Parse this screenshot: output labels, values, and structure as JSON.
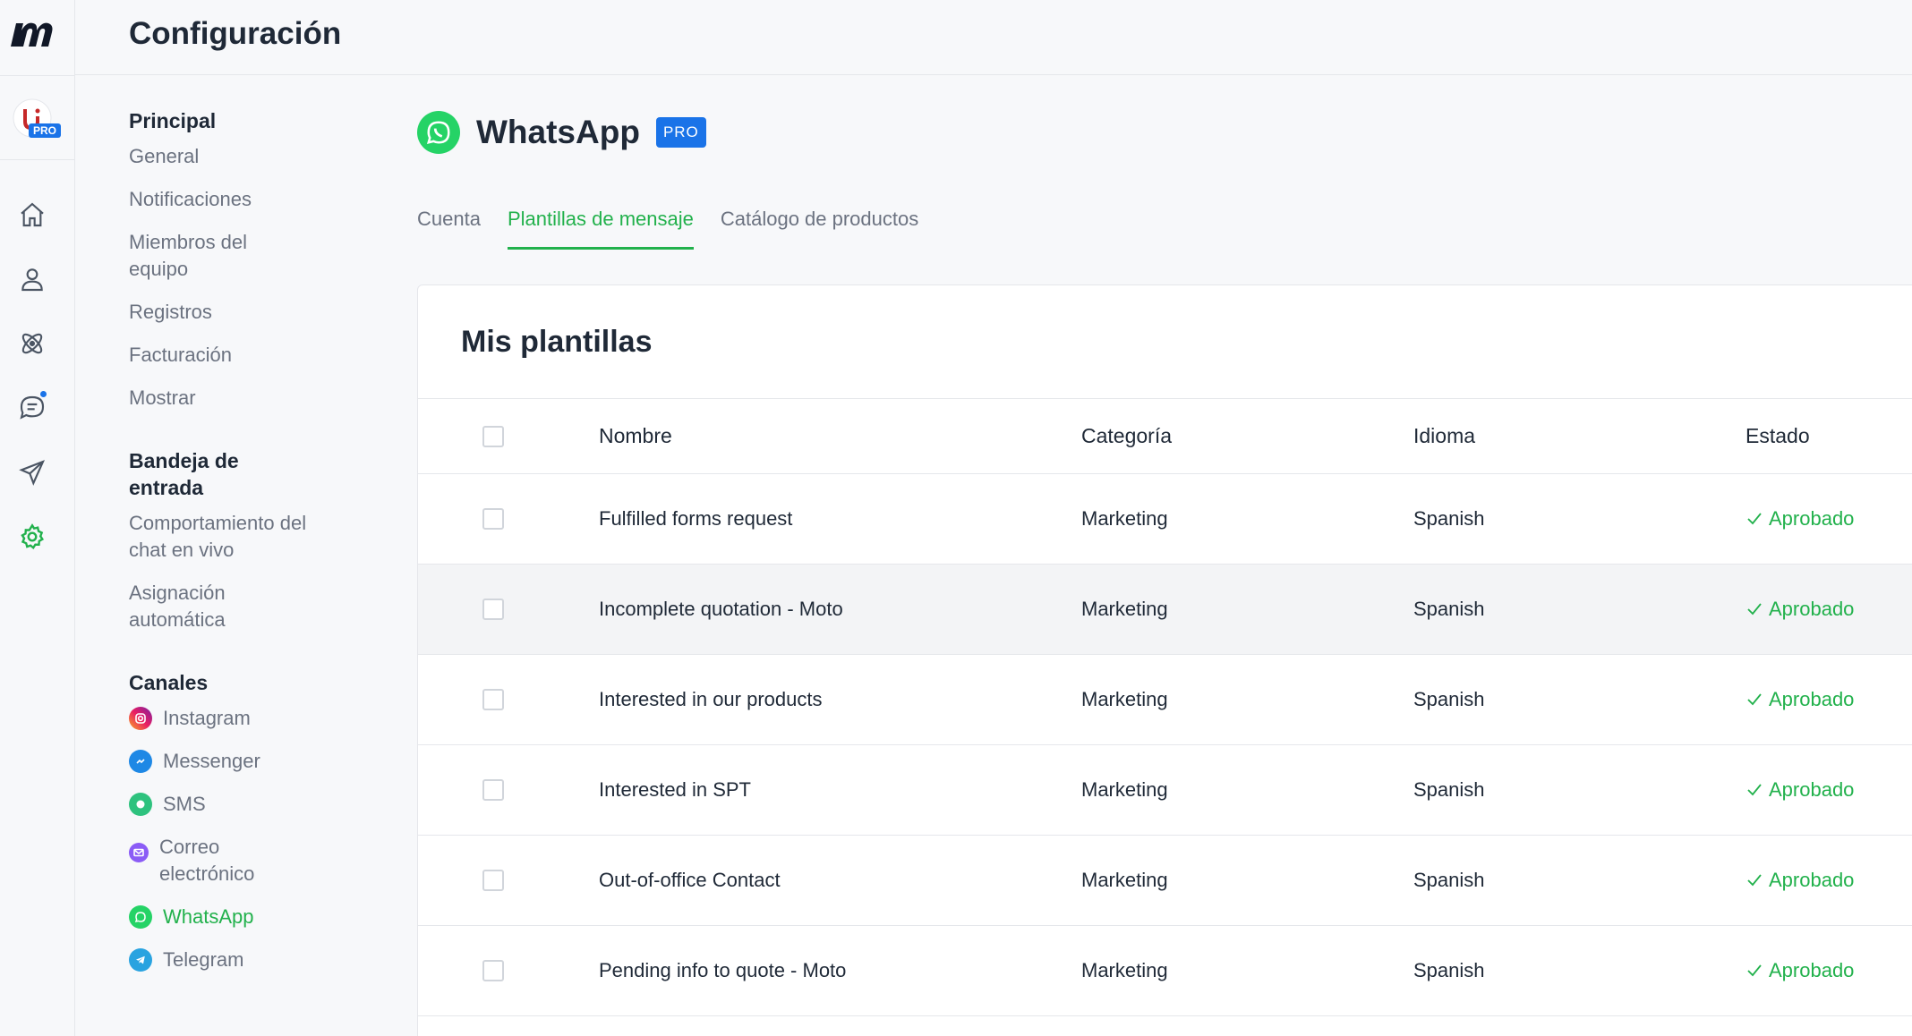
{
  "header": {
    "title": "Configuración"
  },
  "rail": {
    "pro_label": "PRO",
    "accent": "#22b14c",
    "badge_color": "#1a73e8"
  },
  "sidebar": {
    "groups": [
      {
        "title": "Principal",
        "items": [
          "General",
          "Notificaciones",
          "Miembros del equipo",
          "Registros",
          "Facturación",
          "Mostrar"
        ]
      },
      {
        "title": "Bandeja de entrada",
        "items": [
          "Comportamiento del chat en vivo",
          "Asignación automática"
        ]
      },
      {
        "title": "Canales",
        "items": [
          {
            "label": "Instagram",
            "icon": "instagram-icon"
          },
          {
            "label": "Messenger",
            "icon": "messenger-icon"
          },
          {
            "label": "SMS",
            "icon": "sms-icon"
          },
          {
            "label": "Correo electrónico",
            "icon": "email-icon"
          },
          {
            "label": "WhatsApp",
            "icon": "whatsapp-icon"
          },
          {
            "label": "Telegram",
            "icon": "telegram-icon"
          }
        ]
      }
    ]
  },
  "main": {
    "title": "WhatsApp",
    "badge": "PRO",
    "tabs": [
      {
        "label": "Cuenta"
      },
      {
        "label": "Plantillas de mensaje"
      },
      {
        "label": "Catálogo de productos"
      }
    ],
    "card_title": "Mis plantillas",
    "table": {
      "columns": [
        "Nombre",
        "Categoría",
        "Idioma",
        "Estado"
      ],
      "rows": [
        {
          "name": "Fulfilled forms request",
          "category": "Marketing",
          "language": "Spanish",
          "status": "Aprobado"
        },
        {
          "name": "Incomplete quotation - Moto",
          "category": "Marketing",
          "language": "Spanish",
          "status": "Aprobado"
        },
        {
          "name": "Interested in our products",
          "category": "Marketing",
          "language": "Spanish",
          "status": "Aprobado"
        },
        {
          "name": "Interested in SPT",
          "category": "Marketing",
          "language": "Spanish",
          "status": "Aprobado"
        },
        {
          "name": "Out-of-office Contact",
          "category": "Marketing",
          "language": "Spanish",
          "status": "Aprobado"
        },
        {
          "name": "Pending info to quote - Moto",
          "category": "Marketing",
          "language": "Spanish",
          "status": "Aprobado"
        }
      ]
    }
  }
}
